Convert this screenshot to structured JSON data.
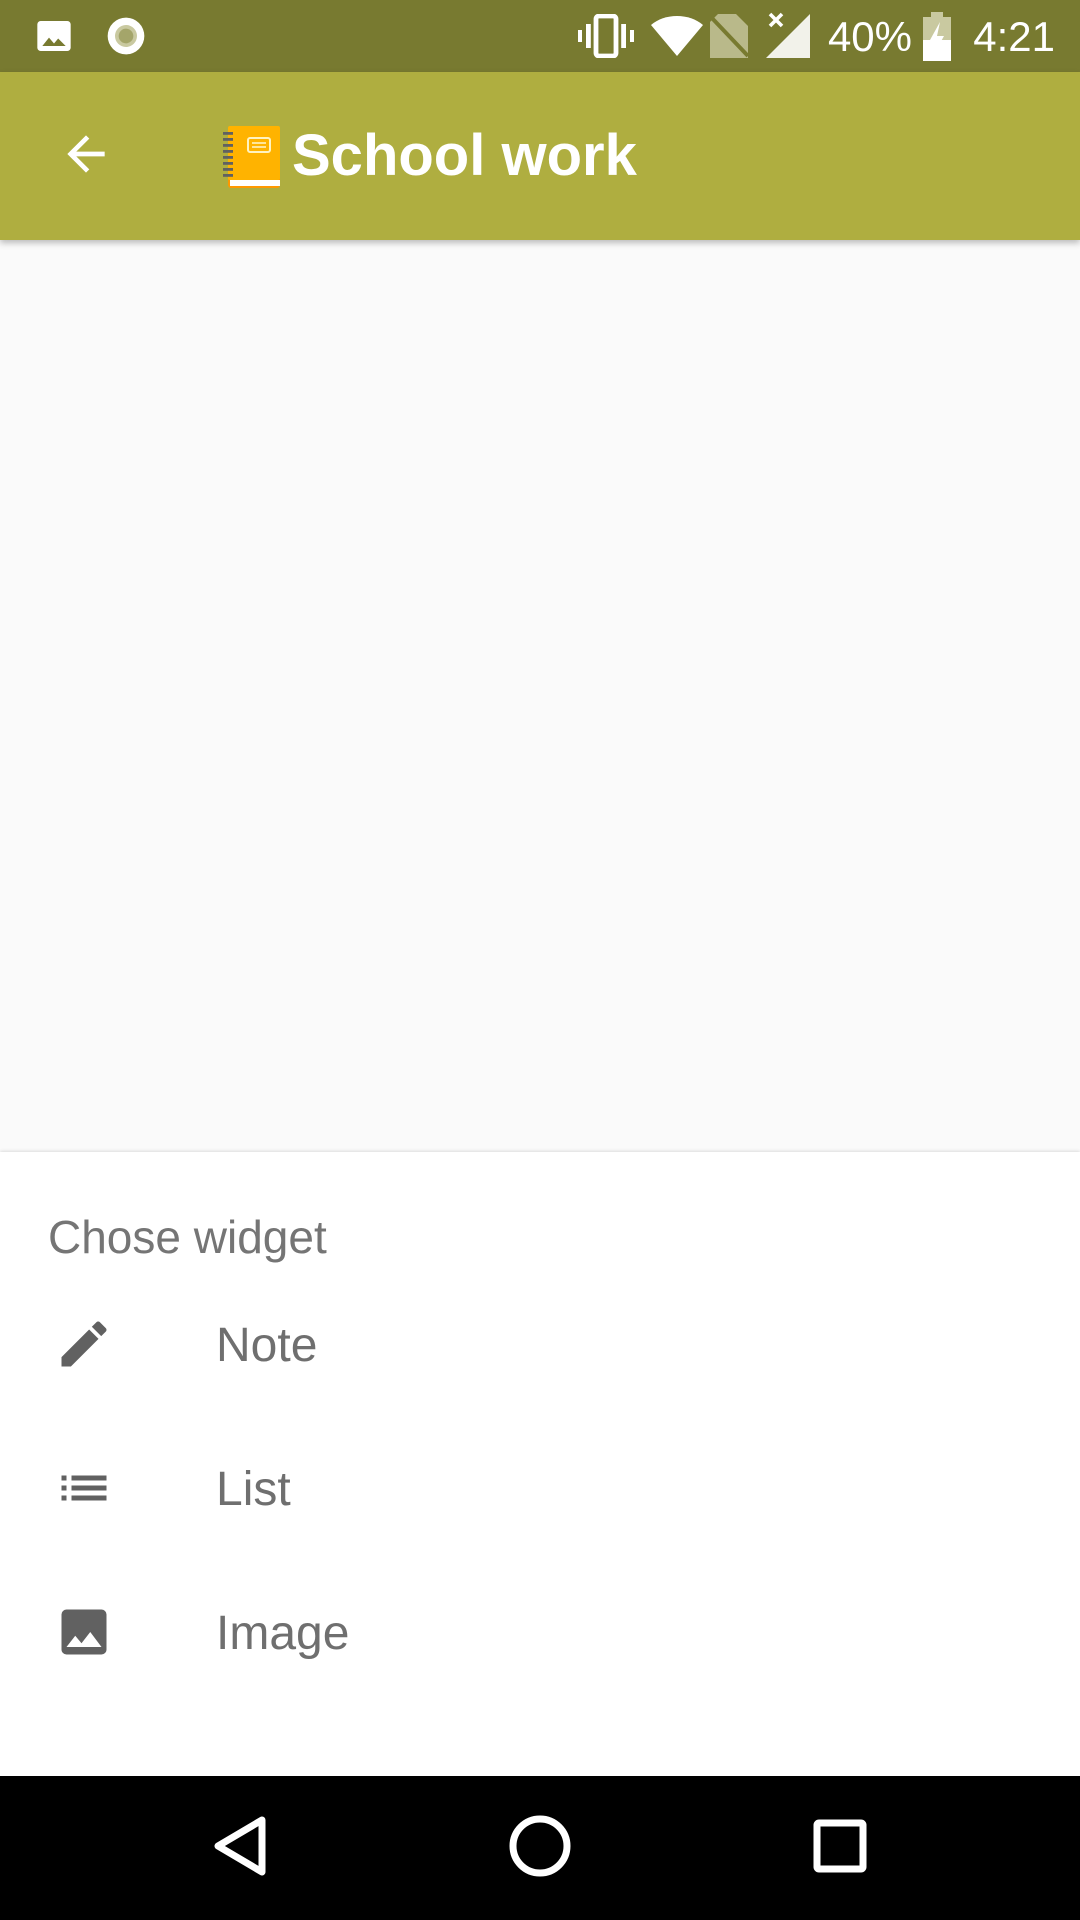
{
  "status_bar": {
    "battery_percent": "40%",
    "time": "4:21",
    "icons": [
      "image-icon",
      "record-icon",
      "vibrate-icon",
      "wifi-icon",
      "no-sim-icon",
      "signal-icon",
      "battery-charging-icon"
    ]
  },
  "app_bar": {
    "title": "School work",
    "back_icon": "arrow-back-icon",
    "title_icon": "notebook-icon",
    "background_color": "#afae40"
  },
  "bottom_sheet": {
    "title": "Chose widget",
    "items": [
      {
        "label": "Note",
        "icon": "pencil-icon"
      },
      {
        "label": "List",
        "icon": "list-icon"
      },
      {
        "label": "Image",
        "icon": "image-icon"
      }
    ]
  },
  "nav_bar": {
    "buttons": [
      "back-triangle-icon",
      "home-circle-icon",
      "recents-square-icon"
    ]
  }
}
